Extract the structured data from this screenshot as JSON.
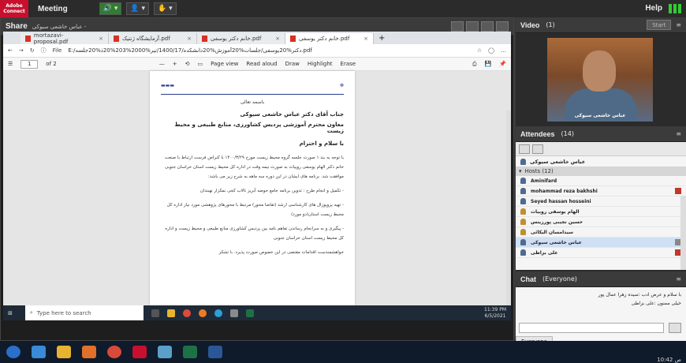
{
  "topbar": {
    "logo_line1": "Adobe",
    "logo_line2": "Connect",
    "meeting_label": "Meeting",
    "help_label": "Help",
    "mic_symbol": "🔊",
    "cam_symbol": "👤",
    "hand_symbol": "✋"
  },
  "share_pod": {
    "title": "Share",
    "subtitle": "عباس خاشعی سیوکی -"
  },
  "browser": {
    "tabs": [
      {
        "label": "mortazavi-proposal.pdf"
      },
      {
        "label": "آزمایشگاه ژنتیک.pdf"
      },
      {
        "label": "خانم دکتر یوسفی.pdf"
      },
      {
        "label": "خانم دکتر یوسفی.pdf"
      }
    ],
    "new_tab": "+",
    "file_label": "File",
    "url": "E:/دکتر%20یوسفی/جلسات%20آموزش%20دانشکده/1400/17/تیر%2000%203%20ذ%20جلسه.pdf",
    "page_current": "1",
    "page_total": "of 2",
    "zoom_minus": "—",
    "zoom_plus": "+",
    "page_view": "Page view",
    "read_aloud": "Read aloud",
    "draw": "Draw",
    "highlight": "Highlight",
    "erase": "Erase"
  },
  "document": {
    "basmala": "باسمه تعالی",
    "recipient": "جناب آقای دکتر عباس خاشعی سیوکی",
    "recipient_title": "معاون محترم آموزشی پردیس کشاورزی، منابع طبیعی و محیط زیست",
    "greeting": "با سلام و احترام",
    "para1": "با توجه به بند ۱ صورت جلسه گروه محیط زیست مورخ ۱۴۰۰/۳/۲۹ با کنراض فرست ارتباط با صنعت خانم دکتر الهام یوسفی روییات به صورت نیمه وقت در اداره کل محیط زیست استان خراسان جنوبی موافقت شد. برنامه های ایشان در این دوره سه ماهه به شرح زیر می باشد:",
    "para2": "- تکمیل و انجام طرح : تدوین برنامه جامع حوضه آبریز تالاب کجی نمکزار نهبندان",
    "para3": "- تهیه پروپوزال های کارشناسی ارشد (تقاضا محور) مرتبط با محورهای پژوهشی مورد نیاز اداره کل محیط زیست استان(دو مورد)",
    "para4": "- پیگیری و به سرانجام رساندن تفاهم نامه بین پردیس کشاورزی منابع طبیعی و محیط زیست و اداره کل محیط زیست استان خراسان جنوبی",
    "closing": "خواهشمندست اقدامات مقتضی در این خصوص صورت پذیرد. با تشکر"
  },
  "pc_taskbar": {
    "search_placeholder": "Type here to search",
    "time": "11:39 PM",
    "date": "6/5/2021"
  },
  "video_pod": {
    "title": "Video",
    "count": "(1)",
    "start_label": "Start",
    "person_name": "عباس خاشعی سیوکی"
  },
  "attendees": {
    "title": "Attendees",
    "count": "(14)",
    "me": "عباس خاشعی سیوکی",
    "hosts_label": "Hosts (12)",
    "rows": [
      {
        "name": "Aminifard"
      },
      {
        "name": "mohammad reza bakhshi"
      },
      {
        "name": "Seyed hassan hosseini"
      },
      {
        "name": "الهام یوسفی روییات"
      },
      {
        "name": "حسین نجیبی پورزینس"
      },
      {
        "name": "سیدامسان الیکائی"
      },
      {
        "name": "عباس خاشعی سیوکی"
      },
      {
        "name": "علی بزاظی"
      }
    ]
  },
  "chat": {
    "title": "Chat",
    "scope": "(Everyone)",
    "line1": "با سلام و عرض ادب :سیده زهرا عمال پور",
    "line2": "خیلی ممنون :علی بزاظی",
    "everyone_tab": "Everyone"
  },
  "win_taskbar": {
    "time": "10:42 ص"
  }
}
